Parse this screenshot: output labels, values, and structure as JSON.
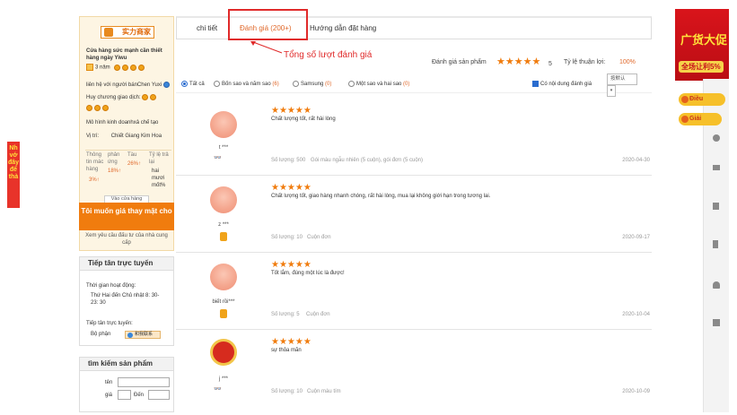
{
  "left_ad": {
    "lines": [
      "Nh",
      "vớ",
      "đây",
      "để",
      "thà"
    ]
  },
  "shop": {
    "logo_text": "实力商家",
    "name": "Cửa hàng sức mạnh cần thiết hàng ngày Yiwu",
    "years": "3 năm",
    "affiliation": "liên hệ với người bánChen Yuxi",
    "medal_label": "Huy chương giao dịch:",
    "model": "Mô hình kinh doanhxả chế tạo",
    "location_label": "Vị trí:",
    "location": "Chiết Giang Kim Hoa",
    "stats_headers": [
      "Thông tin mác hàng",
      "phản ứng",
      "Tàu",
      "Tỷ lệ trả lại"
    ],
    "stats_values": [
      "3%↑",
      "18%↑",
      "26%↑",
      "hai mươi mốt%"
    ],
    "visit_button": "Vào cửa hàng",
    "contact_button": "Tôi muốn giá thay mặt cho",
    "contact_sub": "Xem yêu cầu đấu tư của nhà cung cấp"
  },
  "reception": {
    "title": "Tiếp tân trực tuyến",
    "hours_label": "Thời gian hoạt động:",
    "hours": "Thứ Hai đến Chủ nhật 8: 30-23: 30",
    "staff_label": "Tiếp tân trực tuyến:",
    "department": "Bộ phận",
    "chat_button": "和我联系"
  },
  "product_search": {
    "title": "tìm kiếm sản phẩm",
    "name_label": "tên",
    "price_label": "giá",
    "to_label": "Đến"
  },
  "tabs": {
    "details": "chi tiết",
    "reviews": "Đánh giá (200+)",
    "ordering": "Hướng dẫn đặt hàng"
  },
  "annotation": "Tổng số lượt đánh giá",
  "summary": {
    "rating_label": "Đánh giá sản phẩm",
    "rating_value": "5",
    "rating_stars": 5,
    "positive_label": "Tỷ lệ thuận lợi:",
    "positive_value": "100%"
  },
  "filters": {
    "all": "Tất cả",
    "four_five": "Bốn sao và năm sao",
    "four_five_count": "(6)",
    "samsung": "Samsung",
    "samsung_count": "(0)",
    "one_two": "Một sao và hai sao",
    "one_two_count": "(0)",
    "with_content": "Có nội dung đánh giá",
    "sort_placeholder": "按默认"
  },
  "reviews": [
    {
      "user": "t ***",
      "text": "Chất lượng tốt, rất hài lòng",
      "qty": "Số lượng: 500",
      "variant": "Gói màu ngẫu nhiên (5 cuộn), gói đơn (5 cuộn)",
      "date": "2020-04-30"
    },
    {
      "user": "z ***",
      "text": "Chất lượng tốt, giao hàng nhanh chóng, rất hài lòng, mua lại không giới hạn trong tương lai.",
      "qty": "Số lượng: 10",
      "variant": "Cuộn đơn",
      "date": "2020-09-17"
    },
    {
      "user": "biết rồi***",
      "text": "Tốt lắm, đúng một lúc là được!",
      "qty": "Số lượng: 5",
      "variant": "Cuộn đơn",
      "date": "2020-10-04"
    },
    {
      "user": "j ***",
      "text": "sự thỏa mãn",
      "qty": "Số lượng: 10",
      "variant": "Cuộn màu tím",
      "date": "2020-10-09"
    }
  ],
  "right_panel": {
    "banner_text": "广货大促",
    "banner_sub": "全场让利5%",
    "pill1": "Điều",
    "pill2": "Giải"
  }
}
